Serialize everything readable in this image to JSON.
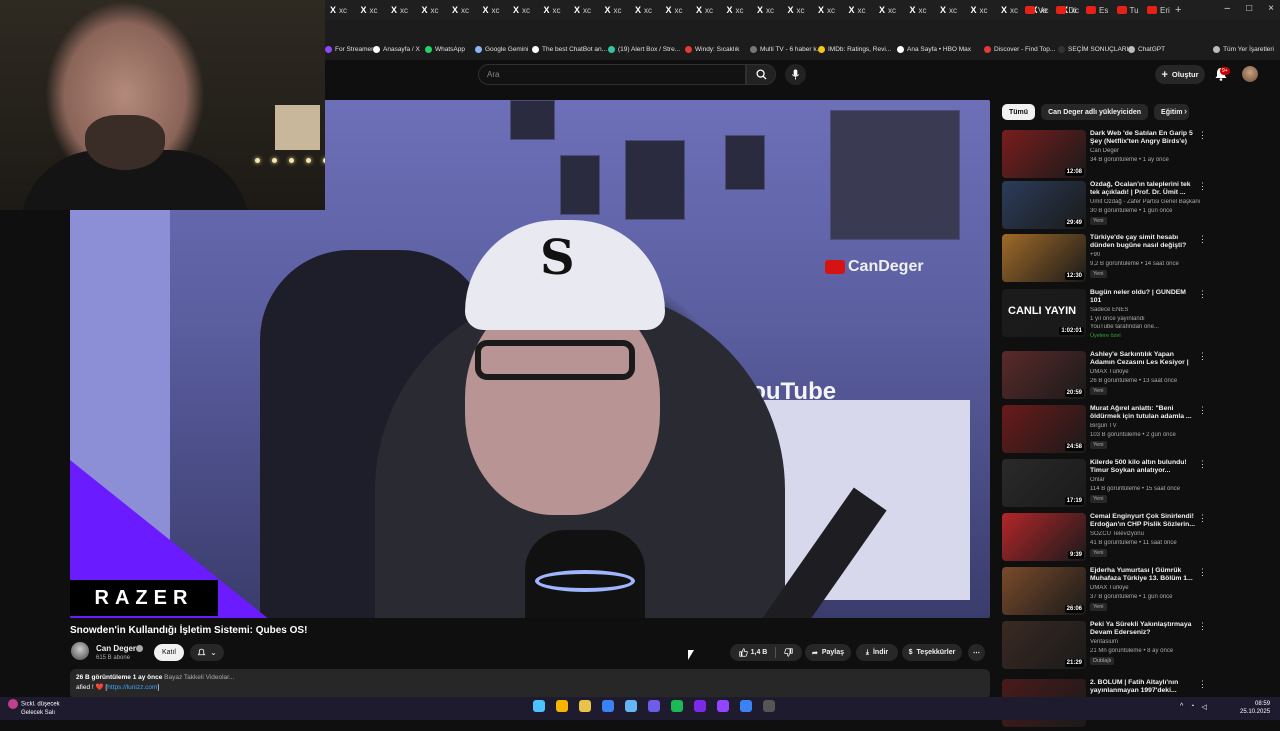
{
  "tabs": {
    "x_label": "X",
    "x_tab_text": "xc",
    "red_tabs": [
      "Ve",
      "Di",
      "Es",
      "Tu",
      "Eri"
    ],
    "new_tab": "+"
  },
  "window_controls": [
    "–",
    "□",
    "×"
  ],
  "bookmarks": [
    {
      "label": "For Streamers",
      "color": "#9146ff"
    },
    {
      "label": "Anasayfa / X",
      "color": "#ffffff"
    },
    {
      "label": "WhatsApp",
      "color": "#25d366"
    },
    {
      "label": "Google Gemini",
      "color": "#8ab4f8"
    },
    {
      "label": "The best ChatBot an...",
      "color": "#ffffff"
    },
    {
      "label": "(19) Alert Box / Stre...",
      "color": "#31c3a2"
    },
    {
      "label": "Windy: Sıcaklık",
      "color": "#e53935"
    },
    {
      "label": "Multi TV - 6 haber k...",
      "color": "#777777"
    },
    {
      "label": "IMDb: Ratings, Revi...",
      "color": "#f5c518"
    },
    {
      "label": "Ana Sayfa • HBO Max",
      "color": "#ffffff"
    },
    {
      "label": "Discover - Find Top...",
      "color": "#e53935"
    },
    {
      "label": "SEÇİM SONUÇLARI...",
      "color": "#333333"
    },
    {
      "label": "ChatGPT",
      "color": "#bbbbbb"
    },
    {
      "label": "Tüm Yer İşaretleri",
      "color": "#bbbbbb"
    }
  ],
  "masthead": {
    "search_placeholder": "Ara",
    "create_label": "Oluştur",
    "notif_badge": "9+"
  },
  "video": {
    "razer_text": "RAZER",
    "youtube_logo_text": "YouTube",
    "candeger_logo_text": "CanDeger",
    "cap_logo": "S"
  },
  "video_info": {
    "title": "Snowden'in Kullandığı İşletim Sistemi: Qubes OS!",
    "channel_name": "Can Deger",
    "subscribers": "615 B abone",
    "join_label": "Katıl",
    "like_count": "1,4 B",
    "share_label": "Paylaş",
    "download_label": "İndir",
    "thanks_label": "Teşekkürler",
    "more_label": "⋯",
    "desc_meta": "26 B görüntüleme  1 ay önce",
    "desc_tags": "Bayaz Takkeli Videolar...",
    "desc_line2_prefix": "afied ! ❤️ [",
    "desc_link": "https://lunizz.com",
    "desc_line2_suffix": "]"
  },
  "chips": [
    {
      "label": "Tümü",
      "active": true
    },
    {
      "label": "Can Deger adlı yükleyiciden",
      "active": false
    },
    {
      "label": "Eğitim",
      "active": false
    }
  ],
  "chip_next": "›",
  "recommendations": [
    {
      "title": "Dark Web 'de Satılan En Garip 5 Şey (Netflix'ten Angry Birds'e)",
      "channel": "Can Deger",
      "meta": "34 B görüntüleme • 1 ay önce",
      "duration": "12:08",
      "badge": "",
      "thumb": "#7a1d1d"
    },
    {
      "title": "Özdağ, Öcalan'ın taleplerini tek tek açıkladı! | Prof. Dr. Ümit ...",
      "channel": "Ümit Özdağ - Zafer Partisi Genel Başkanı",
      "meta": "30 B görüntüleme • 1 gün önce",
      "duration": "29:49",
      "badge": "Yeni",
      "thumb": "#2b3c5a"
    },
    {
      "title": "Türkiye'de çay simit hesabı dünden bugüne nasıl değişti?",
      "channel": "+90",
      "meta": "9,2 B görüntüleme • 14 saat önce",
      "duration": "12:30",
      "badge": "Yeni",
      "thumb": "#a06a28"
    },
    {
      "title": "Bugün neler oldu? | GÜNDEM 101",
      "channel": "Sadece ENES",
      "meta": "1 yıl önce yayınlandı",
      "duration": "1:02:01",
      "badge": "Üyelere özel",
      "badge_green": true,
      "meta2": "YouTube tarafından öne...",
      "thumb": "#1b1b1b",
      "overlay": "CANLI YAYIN"
    },
    {
      "title": "Ashley'e Sarkıntılık Yapan Adamın Cezasını Les Kesiyor | ...",
      "channel": "DMAX Türkiye",
      "meta": "26 B görüntüleme • 13 saat önce",
      "duration": "20:59",
      "badge": "Yeni",
      "thumb": "#5b2a2a"
    },
    {
      "title": "Murat Ağırel anlattı: \"Beni öldürmek için tutulan adamla ...",
      "channel": "Birgün TV",
      "meta": "103 B görüntüleme • 2 gün önce",
      "duration": "24:58",
      "badge": "Yeni",
      "thumb": "#6b1a1a"
    },
    {
      "title": "Kilerde 500 kilo altın bulundu! Timur Soykan anlatıyor...",
      "channel": "Onlar",
      "meta": "114 B görüntüleme • 15 saat önce",
      "duration": "17:19",
      "badge": "Yeni",
      "thumb": "#2a2a2a"
    },
    {
      "title": "Cemal Enginyurt Çok Sinirlendi! Erdoğan'ın CHP Pislik Sözlerin...",
      "channel": "SÖZCÜ Televizyonu",
      "meta": "41 B görüntüleme • 11 saat önce",
      "duration": "9:39",
      "badge": "Yeni",
      "thumb": "#b3262a"
    },
    {
      "title": "Ejderha Yumurtası | Gümrük Muhafaza Türkiye 13. Bölüm 1...",
      "channel": "DMAX Türkiye",
      "meta": "37 B görüntüleme • 1 gün önce",
      "duration": "26:06",
      "badge": "Yeni",
      "thumb": "#7a4a2a"
    },
    {
      "title": "Peki Ya Sürekli Yakınlaştırmaya Devam Ederseniz?",
      "channel": "Veritasium",
      "meta": "21 Mn görüntüleme • 8 ay önce",
      "duration": "21:29",
      "badge": "Dublajlı",
      "thumb": "#3a2a22"
    },
    {
      "title": "2. BÖLÜM | Fatih Altaylı'nın yayınlanmayan 1997'deki...",
      "channel": "",
      "meta": "",
      "duration": "",
      "badge": "",
      "thumb": "#4a1a1a"
    }
  ],
  "taskbar": {
    "weather_line1": "Sıckl. düşecek",
    "weather_line2": "Gelecek Salı",
    "clock_time": "08:59",
    "clock_date": "25.10.2025",
    "app_colors": [
      "#4cc2ff",
      "#f4b400",
      "#e8c34a",
      "#3b82f6",
      "#64b5f6",
      "#6c5ce7",
      "#1db954",
      "#7d2ae8",
      "#9146ff",
      "#3b82f6",
      "#555555"
    ]
  }
}
